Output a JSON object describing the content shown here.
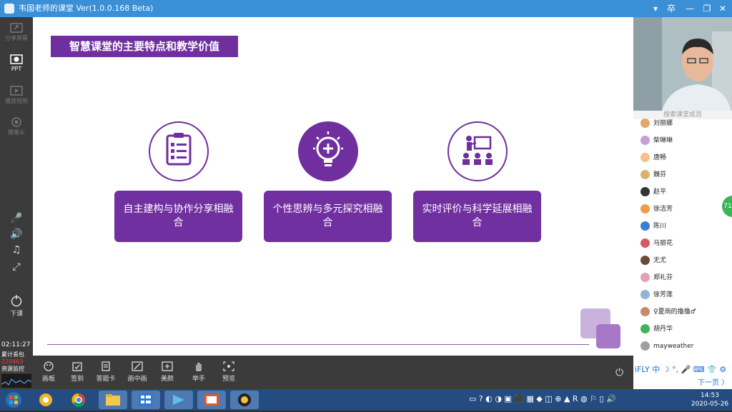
{
  "window": {
    "title": "韦国老师的课堂 Ver(1.0.0.168 Beta)",
    "controls": [
      "▾",
      "卒",
      "—",
      "❐",
      "✕"
    ]
  },
  "sidebar": {
    "items": [
      {
        "label": "分享屏幕",
        "icon": "share-screen-icon"
      },
      {
        "label": "PPT",
        "icon": "ppt-icon"
      },
      {
        "label": "播放视频",
        "icon": "play-video-icon"
      },
      {
        "label": "摄像头",
        "icon": "camera-icon"
      }
    ],
    "controls": [
      "🎤",
      "🔊",
      "♫",
      "⤢"
    ],
    "end_label": "下课",
    "clock": "02:11:27",
    "stats_label": "累计丢包",
    "stats_value": "220463",
    "monitor_label": "资源监控"
  },
  "slide": {
    "title": "智慧课堂的主要特点和教学价值",
    "features": [
      {
        "text": "自主建构与协作分享相融合",
        "icon": "clipboard-checklist-icon"
      },
      {
        "text": "个性思辨与多元探究相融合",
        "icon": "lightbulb-icon"
      },
      {
        "text": "实时评价与科学延展相融合",
        "icon": "teacher-board-icon"
      }
    ]
  },
  "toolbar": {
    "tools": [
      {
        "label": "画板",
        "icon": "palette-icon"
      },
      {
        "label": "签到",
        "icon": "checkin-icon"
      },
      {
        "label": "答题卡",
        "icon": "answer-card-icon"
      },
      {
        "label": "画中画",
        "icon": "pip-icon"
      },
      {
        "label": "美颜",
        "icon": "beauty-icon"
      },
      {
        "label": "举手",
        "icon": "hand-icon"
      },
      {
        "label": "预览",
        "icon": "preview-icon"
      }
    ]
  },
  "panel": {
    "search_placeholder": "搜索课堂成员",
    "students": [
      {
        "name": "刘丽娜",
        "color": "#e0a96d"
      },
      {
        "name": "柴琳琳",
        "color": "#c2a0d8"
      },
      {
        "name": "唐畅",
        "color": "#f4c28a"
      },
      {
        "name": "魏芬",
        "color": "#d9b36e"
      },
      {
        "name": "赵平",
        "color": "#333333"
      },
      {
        "name": "徐洁芳",
        "color": "#f29b4a"
      },
      {
        "name": "陈川",
        "color": "#3a7fd1"
      },
      {
        "name": "马丽花",
        "color": "#d45a6a"
      },
      {
        "name": "无尤",
        "color": "#6c4a3a"
      },
      {
        "name": "郑礼芬",
        "color": "#e6a0b5"
      },
      {
        "name": "徐芳莲",
        "color": "#8fb4d6"
      },
      {
        "name": "♀夏雨的撸撸♂",
        "color": "#c68b6e"
      },
      {
        "name": "胡丹华",
        "color": "#3cb45a"
      },
      {
        "name": "mayweather",
        "color": "#a0a0a0"
      }
    ],
    "next_page": "下一页 〉",
    "badge": "71",
    "ime": "iFLY 中 ☽ °, 🎤 ⌨ 👕 ⚙"
  },
  "taskbar": {
    "time": "14:53",
    "date": "2020-05-26"
  },
  "colors": {
    "accent_purple": "#6f2f9e",
    "titlebar_blue": "#3a8fd6",
    "taskbar_blue": "#254c80"
  }
}
